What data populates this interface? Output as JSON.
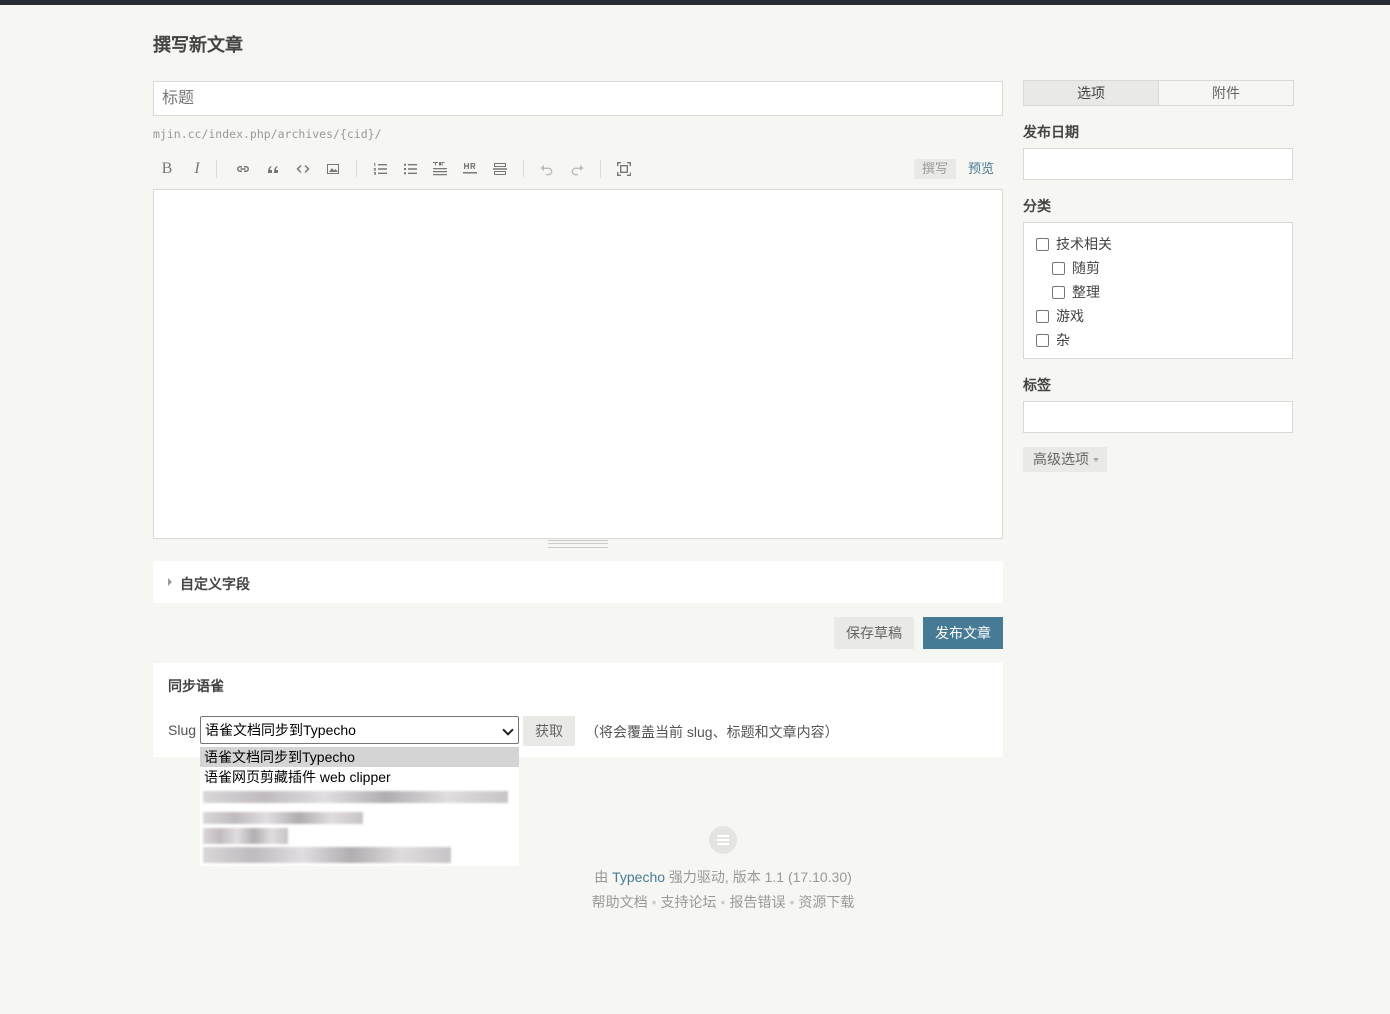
{
  "page": {
    "title": "撰写新文章"
  },
  "editor": {
    "title_placeholder": "标题",
    "permalink": "mjin.cc/index.php/archives/{cid}/",
    "toolbar": {
      "buttons": [
        "bold",
        "italic",
        "link",
        "quote",
        "code",
        "image",
        "ordered-list",
        "unordered-list",
        "heading",
        "hr",
        "more",
        "undo",
        "redo",
        "fullscreen"
      ],
      "bold_glyph": "B",
      "italic_glyph": "I",
      "write_label": "撰写",
      "preview_label": "预览"
    },
    "custom_fields_label": "自定义字段"
  },
  "actions": {
    "save_draft": "保存草稿",
    "publish": "发布文章"
  },
  "sync": {
    "title": "同步语雀",
    "slug_label": "Slug",
    "selected": "语雀文档同步到Typecho",
    "fetch_label": "获取",
    "note": "（将会覆盖当前 slug、标题和文章内容）",
    "options": [
      "语雀文档同步到Typecho",
      "语雀网页剪藏插件 web clipper"
    ]
  },
  "sidebar": {
    "tabs": [
      "选项",
      "附件"
    ],
    "publish_date_label": "发布日期",
    "category_label": "分类",
    "categories": [
      {
        "name": "技术相关",
        "level": 0
      },
      {
        "name": "随剪",
        "level": 1
      },
      {
        "name": "整理",
        "level": 1
      },
      {
        "name": "游戏",
        "level": 0
      },
      {
        "name": "杂",
        "level": 0
      }
    ],
    "tags_label": "标签",
    "advanced_label": "高级选项"
  },
  "footer": {
    "powered_prefix": "由 ",
    "brand": "Typecho",
    "powered_suffix": " 强力驱动, 版本 1.1 (17.10.30)",
    "links": [
      "帮助文档",
      "支持论坛",
      "报告错误",
      "资源下载"
    ]
  },
  "colors": {
    "accent": "#467b96",
    "topbar": "#292d33",
    "background": "#f6f6f3"
  }
}
